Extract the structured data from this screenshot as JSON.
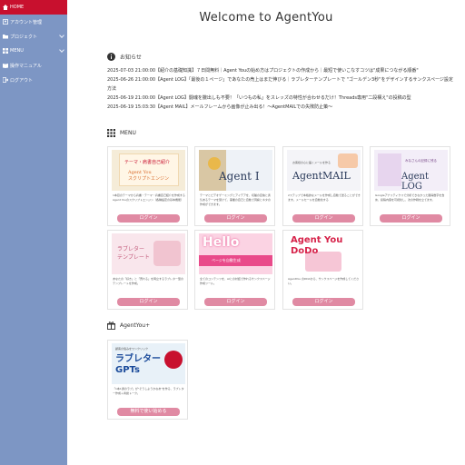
{
  "sidebar": {
    "items": [
      {
        "label": "HOME",
        "icon": "home-icon"
      },
      {
        "label": "アカウント管理",
        "icon": "user-icon"
      },
      {
        "label": "プロジェクト",
        "icon": "folder-icon"
      },
      {
        "label": "MENU",
        "icon": "menu-icon"
      },
      {
        "label": "操作マニュアル",
        "icon": "book-icon"
      },
      {
        "label": "ログアウト",
        "icon": "logout-icon"
      }
    ]
  },
  "page": {
    "title": "Welcome to AgentYou"
  },
  "news": {
    "heading": "お知らせ",
    "items": [
      "2025-07-03 21:00:00【紹介の基礎知識】７日間無料｜Agent Youの始め方はプロジェクトの作成から｜最短で使いこなすコツは\"成果につながる順番\"",
      "2025-06-26 21:00:00【Agent LOG】「最後の１ページ」であなたの売上はまだ伸びる｜ラブレターテンプレートで \"ゴールデン3秒\"をデザインするサンクスページ設定方法",
      "2025-06-19 21:00:00【Agent LOG】闘魂を撒出しも不要！「いつもの私」をスレッズの特性が合わせるだけ！Threads専用\"二段構え\"の投稿の型",
      "2025-06-19 15:03:30【Agent MAIL】メールフレームから画像が止み出る！～AgentMAILでの失敗防止策～"
    ]
  },
  "menu": {
    "heading": "MENU",
    "cards": [
      {
        "thumb_title": "Agent You\nスクリプトエンジン",
        "thumb_sub": "テーマ・肩書自己紹介",
        "desc": "1本目のテーマから肩書・テーマ・肩書自己紹介を作成するAgent Youのスクリプトエンジン（各種設定の基本機能）",
        "button": "ログイン"
      },
      {
        "thumb_title": "Agent I",
        "thumb_sub": "",
        "desc": "テーマとビデオゲーミングとアイデアを、切磋の自信と勇気あるテーマを受けて、事業の自己と自動で洞察とネタの作成ができます。",
        "button": "ログイン"
      },
      {
        "thumb_title": "AgentMAIL",
        "thumb_sub": "お客様の心に届くメールを作る",
        "desc": "2ステップで本格的なメールを作成し自動で送ることができます。メールセールを自動化する",
        "button": "ログイン"
      },
      {
        "thumb_title": "Agent LOG",
        "thumb_sub": "みなさんの記録に残る",
        "desc": "Googleアナリティクスで分析できなかった獲得数字を含め、投稿内容を可視化し、次の作戦を立てます。",
        "button": "ログイン"
      },
      {
        "thumb_title": "ラブレター\nテンプレート",
        "thumb_sub": "",
        "desc": "あなたの「好き」と「売れる」を両立するラブレター型のテンプレートを作成。",
        "button": "ログイン"
      },
      {
        "thumb_title": "Hello",
        "thumb_sub": "ページを自動生成",
        "desc": "全てのコンテンツを、AIとの対話で作れるサンクスページ作成ツール。",
        "button": "ログイン"
      },
      {
        "thumb_title": "Agent You\nDoDo",
        "thumb_sub": "",
        "desc": "AgentYou のDDAから、サンクスページを作成してください。",
        "button": "ログイン"
      },
      {
        "thumb_title": "",
        "thumb_sub": "",
        "desc": "",
        "button": ""
      }
    ]
  },
  "agentyou_plus": {
    "heading": "AgentYou+",
    "card": {
      "thumb_title": "ラブレター\nGPTs",
      "thumb_sub": "顧客の悩みをワンクリック",
      "desc": "「1本1通のラブ」が\"そうしようかなあ\"を作る、ラブレター作成＋商談トーク。",
      "button": "無料で使い始める"
    }
  },
  "colors": {
    "sidebar_bg": "#7d96c4",
    "active": "#c8102e",
    "button": "#e08aa3"
  }
}
